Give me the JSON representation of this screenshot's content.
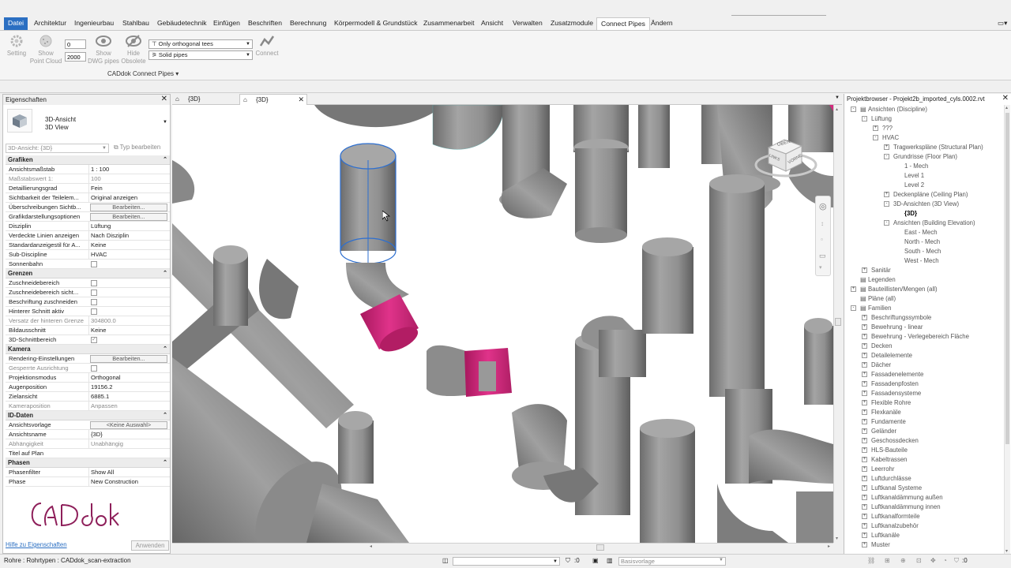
{
  "ribbon": {
    "tabs": [
      "Datei",
      "Architektur",
      "Ingenieurbau",
      "Stahlbau",
      "Gebäudetechnik",
      "Einfügen",
      "Beschriften",
      "Berechnung",
      "Körpermodell & Grundstück",
      "Zusammenarbeit",
      "Ansicht",
      "Verwalten",
      "Zusatzmodule",
      "Connect Pipes",
      "Ändern"
    ],
    "active_tab": "Connect Pipes",
    "setting_label": "Setting",
    "show_point_cloud_label": [
      "Show",
      "Point Cloud"
    ],
    "input_top_value": "0",
    "input_bottom_value": "2000",
    "show_dwg_label": [
      "Show",
      "DWG pipes"
    ],
    "hide_obsolete_label": [
      "Hide",
      "Obsolete"
    ],
    "tees_select": "Only orthogonal tees",
    "pipes_select": "Solid pipes",
    "connect_label": "Connect",
    "panel_title": "CADdok Connect Pipes"
  },
  "properties": {
    "title": "Eigenschaften",
    "type_line1": "3D-Ansicht",
    "type_line2": "3D View",
    "instance_select": "3D-Ansicht: {3D}",
    "edit_type": "Typ bearbeiten",
    "sections": {
      "grafiken": "Grafiken",
      "grenzen": "Grenzen",
      "kamera": "Kamera",
      "id_daten": "ID-Daten",
      "phasen": "Phasen"
    },
    "rows": {
      "r1": {
        "k": "Ansichtsmaßstab",
        "v": "1 : 100"
      },
      "r2": {
        "k": "Maßstabswert 1:",
        "v": "100"
      },
      "r3": {
        "k": "Detaillierungsgrad",
        "v": "Fein"
      },
      "r4": {
        "k": "Sichtbarkeit der Teilelem...",
        "v": "Original anzeigen"
      },
      "r5": {
        "k": "Überschreibungen Sichtb...",
        "v": "Bearbeiten..."
      },
      "r6": {
        "k": "Grafikdarstellungsoptionen",
        "v": "Bearbeiten..."
      },
      "r7": {
        "k": "Disziplin",
        "v": "Lüftung"
      },
      "r8": {
        "k": "Verdeckte Linien anzeigen",
        "v": "Nach Disziplin"
      },
      "r9": {
        "k": "Standardanzeigestil für A...",
        "v": "Keine"
      },
      "r10": {
        "k": "Sub-Discipline",
        "v": "HVAC"
      },
      "r11": {
        "k": "Sonnenbahn",
        "v": ""
      },
      "g1": {
        "k": "Zuschneidebereich",
        "v": ""
      },
      "g2": {
        "k": "Zuschneidebereich sicht...",
        "v": ""
      },
      "g3": {
        "k": "Beschriftung zuschneiden",
        "v": ""
      },
      "g4": {
        "k": "Hinterer Schnitt aktiv",
        "v": ""
      },
      "g5": {
        "k": "Versatz der hinteren Grenze",
        "v": "304800.0"
      },
      "g6": {
        "k": "Bildausschnitt",
        "v": "Keine"
      },
      "g7": {
        "k": "3D-Schnittbereich",
        "v": ""
      },
      "c1": {
        "k": "Rendering-Einstellungen",
        "v": "Bearbeiten..."
      },
      "c2": {
        "k": "Gesperrte Ausrichtung",
        "v": ""
      },
      "c3": {
        "k": "Projektionsmodus",
        "v": "Orthogonal"
      },
      "c4": {
        "k": "Augenposition",
        "v": "19156.2"
      },
      "c5": {
        "k": "Zielansicht",
        "v": "6885.1"
      },
      "c6": {
        "k": "Kameraposition",
        "v": "Anpassen"
      },
      "i1": {
        "k": "Ansichtsvorlage",
        "v": "<Keine Auswahl>"
      },
      "i2": {
        "k": "Ansichtsname",
        "v": "{3D}"
      },
      "i3": {
        "k": "Abhängigkeit",
        "v": "Unabhängig"
      },
      "i4": {
        "k": "Titel auf Plan",
        "v": ""
      },
      "p1": {
        "k": "Phasenfilter",
        "v": "Show All"
      },
      "p2": {
        "k": "Phase",
        "v": "New Construction"
      }
    },
    "logo_text": "CADdok",
    "help_link": "Hilfe zu Eigenschaften",
    "apply_button": "Anwenden"
  },
  "view_tabs": [
    "{3D}",
    "{3D}"
  ],
  "viewcube": {
    "top": "OBEN",
    "front": "VORNE",
    "left": "LINKS"
  },
  "browser": {
    "title": "Projektbrowser - Projekt2b_imported_cyls.0002.rvt",
    "items": [
      "Ansichten (Discipline)",
      "Lüftung",
      "???",
      "HVAC",
      "Tragwerkspläne (Structural Plan)",
      "Grundrisse (Floor Plan)",
      "1 - Mech",
      "Level 1",
      "Level 2",
      "Deckenpläne (Ceiling Plan)",
      "3D-Ansichten (3D View)",
      "{3D}",
      "Ansichten (Building Elevation)",
      "East - Mech",
      "North - Mech",
      "South - Mech",
      "West - Mech",
      "Sanitär",
      "Legenden",
      "Bauteillisten/Mengen (all)",
      "Pläne (all)",
      "Familien",
      "Beschriftungssymbole",
      "Bewehrung - linear",
      "Bewehrung - Verlegebereich Fläche",
      "Decken",
      "Detailelemente",
      "Dächer",
      "Fassadenelemente",
      "Fassadenpfosten",
      "Fassadensysteme",
      "Flexible Rohre",
      "Flexkanäle",
      "Fundamente",
      "Geländer",
      "Geschossdecken",
      "HLS-Bauteile",
      "Kabeltrassen",
      "Leerrohr",
      "Luftdurchlässe",
      "Luftkanal Systeme",
      "Luftkanaldämmung außen",
      "Luftkanaldämmung innen",
      "Luftkanalformteile",
      "Luftkanalzubehör",
      "Luftkanäle",
      "Muster"
    ]
  },
  "status": {
    "left": "Rohre : Rohrtypen : CADdok_scan-extraction",
    "count": ":0",
    "template": "Basisvorlage",
    "filter_count": ":0"
  },
  "colors": {
    "file_tab": "#2b6fc2",
    "selected_pipe": "#d42a7e",
    "pipe_grey": "#8a8a8a",
    "selection_blue": "#2d6fd0"
  }
}
